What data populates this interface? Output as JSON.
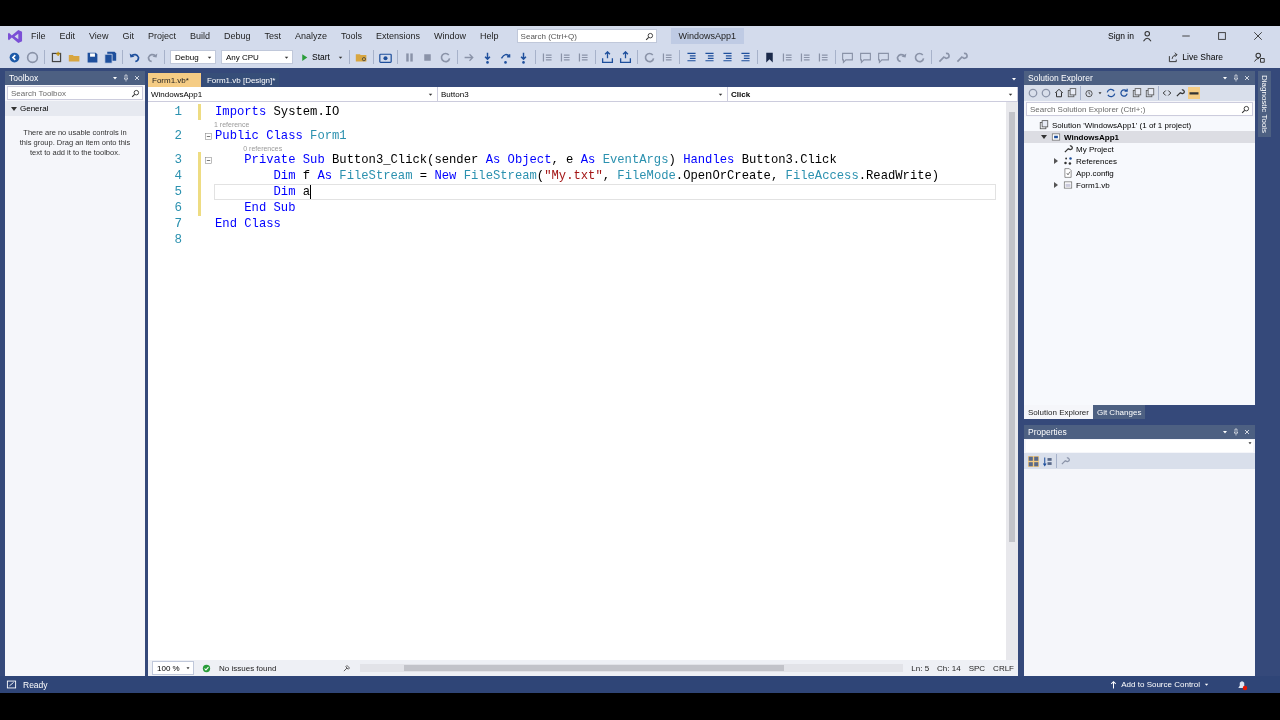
{
  "menu": [
    "File",
    "Edit",
    "View",
    "Git",
    "Project",
    "Build",
    "Debug",
    "Test",
    "Analyze",
    "Tools",
    "Extensions",
    "Window",
    "Help"
  ],
  "search": {
    "placeholder": "Search (Ctrl+Q)"
  },
  "solution_name": "WindowsApp1",
  "account": "Sign in",
  "toolbar": {
    "configuration": "Debug",
    "platform": "Any CPU",
    "start": "Start",
    "live_share": "Live Share"
  },
  "toolbox": {
    "title": "Toolbox",
    "search": {
      "placeholder": "Search Toolbox"
    },
    "group": {
      "label": "General",
      "expanded": true
    },
    "message": "There are no usable controls in this group. Drag an item onto this text to add it to the toolbox."
  },
  "document_tabs": [
    {
      "label": "Form1.vb*",
      "selected": true
    },
    {
      "label": "Form1.vb [Design]*",
      "selected": false
    }
  ],
  "navigation_bar": [
    "WindowsApp1",
    "Button3",
    "Click"
  ],
  "code": {
    "lines": [
      {
        "number": "1",
        "changed": true,
        "collapsible": false,
        "caret": false,
        "tokens": [
          {
            "text": "Imports",
            "kind": "keyword"
          },
          {
            "text": " System.IO",
            "kind": "plain"
          }
        ]
      },
      {
        "number": "2",
        "changed": false,
        "collapsible": true,
        "caret": false,
        "codelens": "1 reference",
        "tokens": [
          {
            "text": "Public Class ",
            "kind": "keyword"
          },
          {
            "text": "Form1",
            "kind": "type"
          }
        ]
      },
      {
        "number": "3",
        "changed": true,
        "collapsible": true,
        "caret": false,
        "codelens": "0 references",
        "tokens": [
          {
            "text": "    Private Sub",
            "kind": "keyword"
          },
          {
            "text": " Button3_Click(sender ",
            "kind": "plain"
          },
          {
            "text": "As Object",
            "kind": "keyword"
          },
          {
            "text": ", e ",
            "kind": "plain"
          },
          {
            "text": "As ",
            "kind": "keyword"
          },
          {
            "text": "EventArgs",
            "kind": "type"
          },
          {
            "text": ") ",
            "kind": "plain"
          },
          {
            "text": "Handles",
            "kind": "keyword"
          },
          {
            "text": " Button3.Click",
            "kind": "plain"
          }
        ]
      },
      {
        "number": "4",
        "changed": true,
        "collapsible": false,
        "caret": false,
        "tokens": [
          {
            "text": "        Dim",
            "kind": "keyword"
          },
          {
            "text": " f ",
            "kind": "plain"
          },
          {
            "text": "As ",
            "kind": "keyword"
          },
          {
            "text": "FileStream",
            "kind": "type"
          },
          {
            "text": " = ",
            "kind": "plain"
          },
          {
            "text": "New ",
            "kind": "keyword"
          },
          {
            "text": "FileStream",
            "kind": "type"
          },
          {
            "text": "(",
            "kind": "plain"
          },
          {
            "text": "\"My.txt\"",
            "kind": "string"
          },
          {
            "text": ", ",
            "kind": "plain"
          },
          {
            "text": "FileMode",
            "kind": "type"
          },
          {
            "text": ".OpenOrCreate, ",
            "kind": "plain"
          },
          {
            "text": "FileAccess",
            "kind": "type"
          },
          {
            "text": ".ReadWrite)",
            "kind": "plain"
          }
        ]
      },
      {
        "number": "5",
        "changed": true,
        "collapsible": false,
        "caret": true,
        "tokens": [
          {
            "text": "        Dim",
            "kind": "keyword"
          },
          {
            "text": " a",
            "kind": "plain"
          }
        ]
      },
      {
        "number": "6",
        "changed": true,
        "collapsible": false,
        "caret": false,
        "tokens": [
          {
            "text": "    End Sub",
            "kind": "keyword"
          }
        ]
      },
      {
        "number": "7",
        "changed": false,
        "collapsible": false,
        "caret": false,
        "tokens": [
          {
            "text": "End Class",
            "kind": "keyword"
          }
        ]
      },
      {
        "number": "8",
        "changed": false,
        "collapsible": false,
        "caret": false
      }
    ]
  },
  "editor_status": {
    "zoom": "100 %",
    "issues": "No issues found",
    "line": "Ln: 5",
    "column": "Ch: 14",
    "whitespace": "SPC",
    "line_ending": "CRLF"
  },
  "solution_explorer": {
    "title": "Solution Explorer",
    "search": {
      "placeholder": "Search Solution Explorer (Ctrl+;)"
    },
    "tree": [
      {
        "label": "Solution 'WindowsApp1' (1 of 1 project)",
        "kind": "solution",
        "selected": false,
        "children": [
          {
            "label": "WindowsApp1",
            "kind": "project",
            "expanded": true,
            "selected": true,
            "children": [
              {
                "label": "My Project",
                "kind": "properties",
                "selected": false
              },
              {
                "label": "References",
                "kind": "references",
                "expanded": false,
                "selected": false
              },
              {
                "label": "App.config",
                "kind": "config",
                "selected": false
              },
              {
                "label": "Form1.vb",
                "kind": "form",
                "expanded": false,
                "selected": false
              }
            ]
          }
        ]
      }
    ],
    "tabs": [
      {
        "label": "Solution Explorer",
        "selected": true
      },
      {
        "label": "Git Changes",
        "selected": false
      }
    ]
  },
  "properties": {
    "title": "Properties"
  },
  "side_tab": "Diagnostic Tools",
  "status_bar": {
    "message": "Ready",
    "source_control": "Add to Source Control"
  }
}
